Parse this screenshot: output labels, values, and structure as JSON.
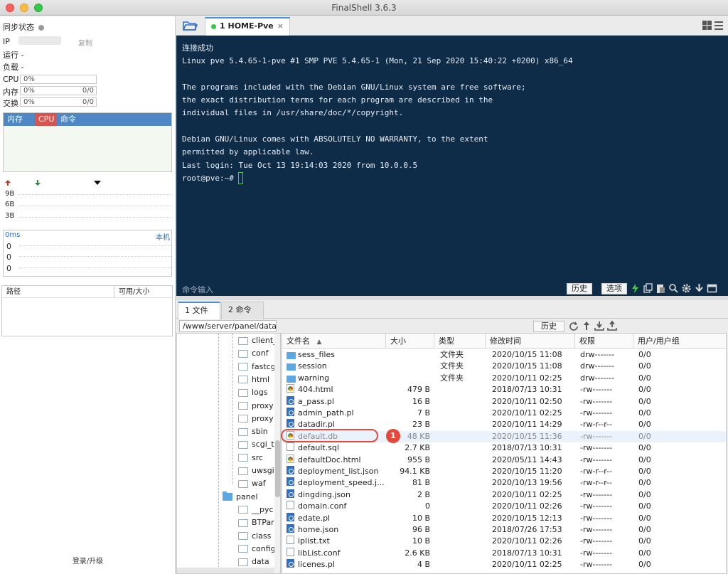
{
  "app": {
    "title": "FinalShell 3.6.3"
  },
  "left": {
    "sync_label": "同步状态",
    "ip_label": "IP",
    "copy_label": "复制",
    "running_label": "运行 -",
    "load_label": "负载 -",
    "cpu": {
      "label": "CPU",
      "value": "0%"
    },
    "mem": {
      "label": "内存",
      "value": "0%",
      "amount": "0/0"
    },
    "swap": {
      "label": "交换",
      "value": "0%",
      "amount": "0/0"
    },
    "proc_tabs": [
      "内存",
      "CPU",
      "命令"
    ],
    "net_scale": [
      "9B",
      "6B",
      "3B"
    ],
    "latency": {
      "label": "0ms",
      "host": "本机",
      "values": [
        "0",
        "0",
        "0"
      ]
    },
    "paths_head": [
      "路径",
      "可用/大小"
    ],
    "login_label": "登录/升级"
  },
  "session": {
    "tab_label": "1 HOME-Pve",
    "close": "×"
  },
  "terminal": {
    "lines": [
      "连接成功",
      "Linux pve 5.4.65-1-pve #1 SMP PVE 5.4.65-1 (Mon, 21 Sep 2020 15:40:22 +0200) x86_64",
      "",
      "The programs included with the Debian GNU/Linux system are free software;",
      "the exact distribution terms for each program are described in the",
      "individual files in /usr/share/doc/*/copyright.",
      "",
      "Debian GNU/Linux comes with ABSOLUTELY NO WARRANTY, to the extent",
      "permitted by applicable law.",
      "Last login: Tue Oct 13 19:14:03 2020 from 10.0.0.5",
      "root@pve:~# "
    ],
    "cmd_placeholder": "命令输入",
    "history_btn": "历史",
    "options_btn": "选项"
  },
  "files": {
    "tabs": [
      "1 文件",
      "2 命令"
    ],
    "path": "/www/server/panel/data",
    "history_btn": "历史",
    "tree": [
      {
        "name": "client_",
        "level": 2,
        "type": "white"
      },
      {
        "name": "conf",
        "level": 2,
        "type": "white"
      },
      {
        "name": "fastcg",
        "level": 2,
        "type": "white"
      },
      {
        "name": "html",
        "level": 2,
        "type": "white"
      },
      {
        "name": "logs",
        "level": 2,
        "type": "white"
      },
      {
        "name": "proxy",
        "level": 2,
        "type": "white"
      },
      {
        "name": "proxy",
        "level": 2,
        "type": "white"
      },
      {
        "name": "sbin",
        "level": 2,
        "type": "white"
      },
      {
        "name": "scgi_t",
        "level": 2,
        "type": "white"
      },
      {
        "name": "src",
        "level": 2,
        "type": "white"
      },
      {
        "name": "uwsgi",
        "level": 2,
        "type": "white"
      },
      {
        "name": "waf",
        "level": 2,
        "type": "white"
      },
      {
        "name": "panel",
        "level": 1,
        "type": "blue"
      },
      {
        "name": "__pyc",
        "level": 2,
        "type": "white"
      },
      {
        "name": "BTPar",
        "level": 2,
        "type": "white"
      },
      {
        "name": "class",
        "level": 2,
        "type": "white"
      },
      {
        "name": "config",
        "level": 2,
        "type": "white"
      },
      {
        "name": "data",
        "level": 2,
        "type": "white"
      }
    ],
    "columns": [
      "文件名",
      "大小",
      "类型",
      "修改时间",
      "权限",
      "用户/用户组"
    ],
    "rows": [
      {
        "name": "sess_files",
        "size": "",
        "type": "文件夹",
        "mtime": "2020/10/15 11:08",
        "perm": "drw-------",
        "owner": "0/0",
        "icon": "folder"
      },
      {
        "name": "session",
        "size": "",
        "type": "文件夹",
        "mtime": "2020/10/15 11:08",
        "perm": "drw-------",
        "owner": "0/0",
        "icon": "folder"
      },
      {
        "name": "warning",
        "size": "",
        "type": "文件夹",
        "mtime": "2020/10/11 02:25",
        "perm": "drw-------",
        "owner": "0/0",
        "icon": "folder"
      },
      {
        "name": "404.html",
        "size": "479 B",
        "type": "",
        "mtime": "2018/07/13 10:31",
        "perm": "-rw-------",
        "owner": "0/0",
        "icon": "chrome"
      },
      {
        "name": "a_pass.pl",
        "size": "16 B",
        "type": "",
        "mtime": "2020/10/11 02:50",
        "perm": "-rw-------",
        "owner": "0/0",
        "icon": "blue"
      },
      {
        "name": "admin_path.pl",
        "size": "7 B",
        "type": "",
        "mtime": "2020/10/11 02:25",
        "perm": "-rw-------",
        "owner": "0/0",
        "icon": "blue"
      },
      {
        "name": "datadir.pl",
        "size": "23 B",
        "type": "",
        "mtime": "2020/10/11 14:29",
        "perm": "-rw-r--r--",
        "owner": "0/0",
        "icon": "blue"
      },
      {
        "name": "default.db",
        "size": "48 KB",
        "type": "",
        "mtime": "2020/10/15 11:36",
        "perm": "-rw-------",
        "owner": "0/0",
        "icon": "chrome",
        "selected": true
      },
      {
        "name": "default.sql",
        "size": "2.7 KB",
        "type": "",
        "mtime": "2018/07/13 10:31",
        "perm": "-rw-------",
        "owner": "0/0",
        "icon": "plain"
      },
      {
        "name": "defaultDoc.html",
        "size": "955 B",
        "type": "",
        "mtime": "2020/05/11 14:43",
        "perm": "-rw-------",
        "owner": "0/0",
        "icon": "chrome"
      },
      {
        "name": "deployment_list.json",
        "size": "94.1 KB",
        "type": "",
        "mtime": "2020/10/15 11:20",
        "perm": "-rw-r--r--",
        "owner": "0/0",
        "icon": "blue"
      },
      {
        "name": "deployment_speed.j...",
        "size": "81 B",
        "type": "",
        "mtime": "2020/10/13 19:56",
        "perm": "-rw-r--r--",
        "owner": "0/0",
        "icon": "blue"
      },
      {
        "name": "dingding.json",
        "size": "2 B",
        "type": "",
        "mtime": "2020/10/11 02:25",
        "perm": "-rw-------",
        "owner": "0/0",
        "icon": "blue"
      },
      {
        "name": "domain.conf",
        "size": "0",
        "type": "",
        "mtime": "2020/10/11 02:26",
        "perm": "-rw-------",
        "owner": "0/0",
        "icon": "plain"
      },
      {
        "name": "edate.pl",
        "size": "10 B",
        "type": "",
        "mtime": "2020/10/15 12:13",
        "perm": "-rw-------",
        "owner": "0/0",
        "icon": "blue"
      },
      {
        "name": "home.json",
        "size": "96 B",
        "type": "",
        "mtime": "2018/07/26 17:53",
        "perm": "-rw-------",
        "owner": "0/0",
        "icon": "blue"
      },
      {
        "name": "iplist.txt",
        "size": "10 B",
        "type": "",
        "mtime": "2020/10/11 02:26",
        "perm": "-rw-------",
        "owner": "0/0",
        "icon": "plain"
      },
      {
        "name": "libList.conf",
        "size": "2.6 KB",
        "type": "",
        "mtime": "2018/07/13 10:31",
        "perm": "-rw-------",
        "owner": "0/0",
        "icon": "plain"
      },
      {
        "name": "licenes.pl",
        "size": "4 B",
        "type": "",
        "mtime": "2020/10/11 02:25",
        "perm": "-rw-------",
        "owner": "0/0",
        "icon": "blue"
      }
    ],
    "annotation_number": "1"
  }
}
